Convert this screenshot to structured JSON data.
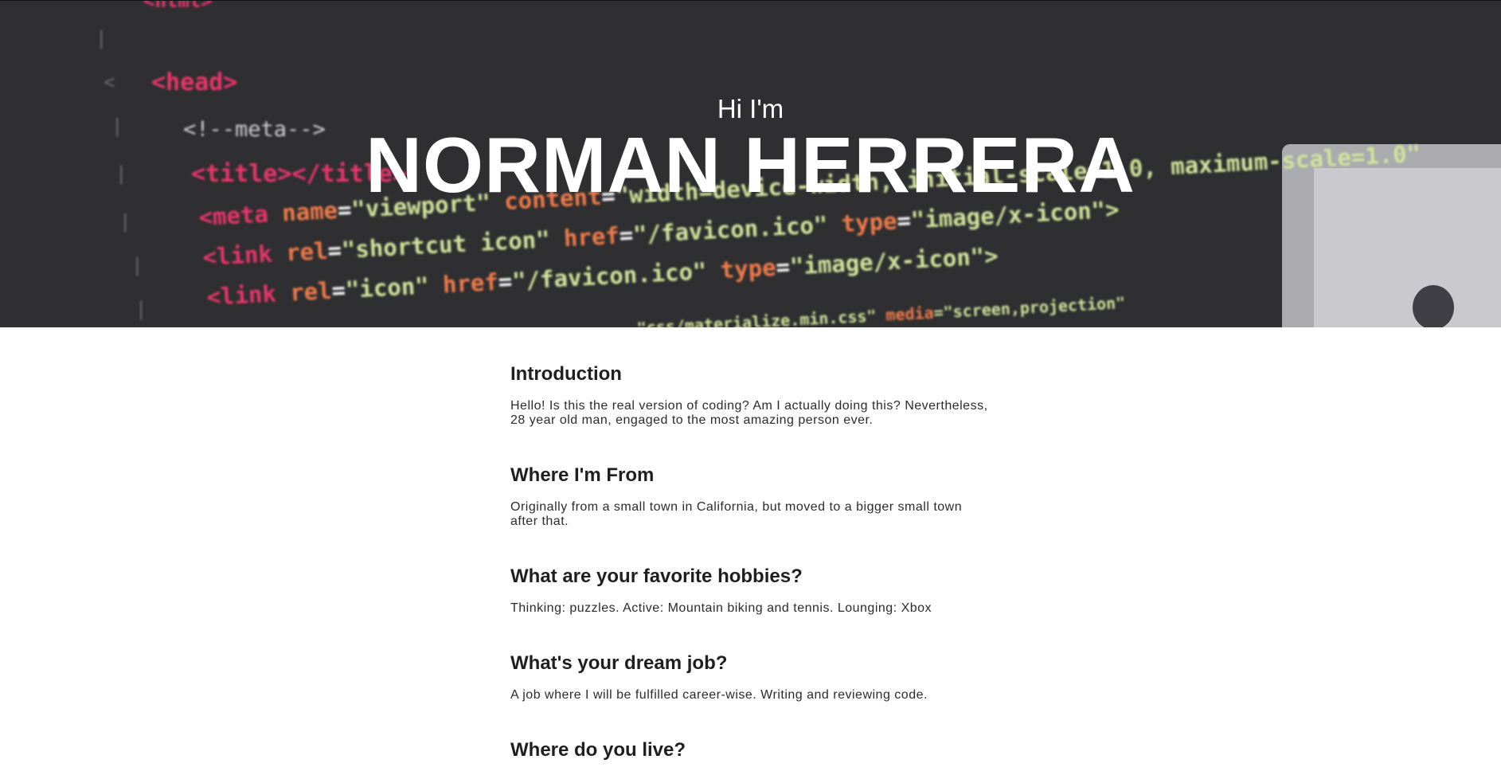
{
  "hero": {
    "kicker": "Hi I'm",
    "name": "NORMAN HERRERA"
  },
  "sections": [
    {
      "heading": "Introduction",
      "body": "Hello! Is this the real version of coding? Am I actually doing this? Nevertheless, 28 year old man, engaged to the most amazing person ever."
    },
    {
      "heading": "Where I'm From",
      "body": "Originally from a small town in California, but moved to a bigger small town after that."
    },
    {
      "heading": "What are your favorite hobbies?",
      "body": "Thinking: puzzles. Active: Mountain biking and tennis. Lounging: Xbox"
    },
    {
      "heading": "What's your dream job?",
      "body": "A job where I will be fulfilled career-wise. Writing and reviewing code."
    },
    {
      "heading": "Where do you live?",
      "body": ""
    }
  ],
  "colors": {
    "hero_bg": "#2f2f31",
    "tag_pink": "#e8366a",
    "attr_orange": "#f07b4a",
    "string_green": "#d3e39a",
    "text_dark": "#1f1f1f"
  }
}
